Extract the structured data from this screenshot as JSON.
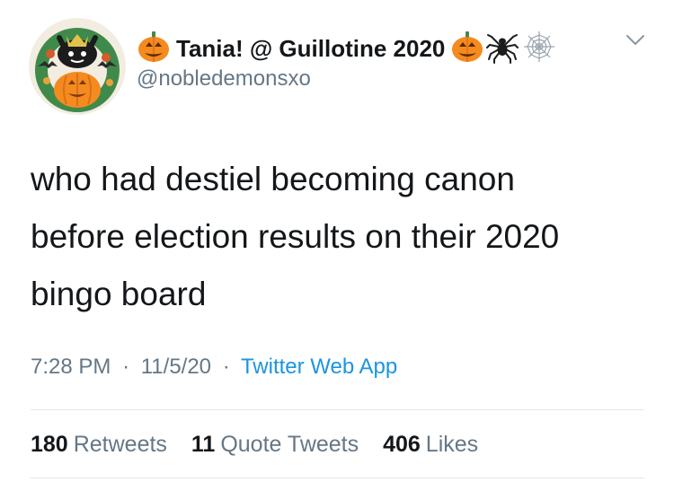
{
  "author": {
    "name": "Tania! @ Guillotine 2020",
    "handle": "@nobledemonsxo",
    "name_icons_left": [
      "jack-o-lantern-icon"
    ],
    "name_icons_right": [
      "jack-o-lantern-icon",
      "spider-icon",
      "spider-web-icon"
    ]
  },
  "tweet": {
    "text": "who had destiel becoming canon\nbefore election results on their 2020\nbingo board",
    "time": "7:28 PM",
    "date": "11/5/20",
    "separator": "·",
    "source": "Twitter Web App"
  },
  "stats": {
    "retweets_count": "180",
    "retweets_label": "Retweets",
    "quote_count": "11",
    "quote_label": "Quote Tweets",
    "likes_count": "406",
    "likes_label": "Likes"
  },
  "colors": {
    "text": "#14171a",
    "secondary": "#657786",
    "link": "#1b95e0",
    "divider": "#e1e8ed",
    "pumpkin": "#f58a1f"
  }
}
